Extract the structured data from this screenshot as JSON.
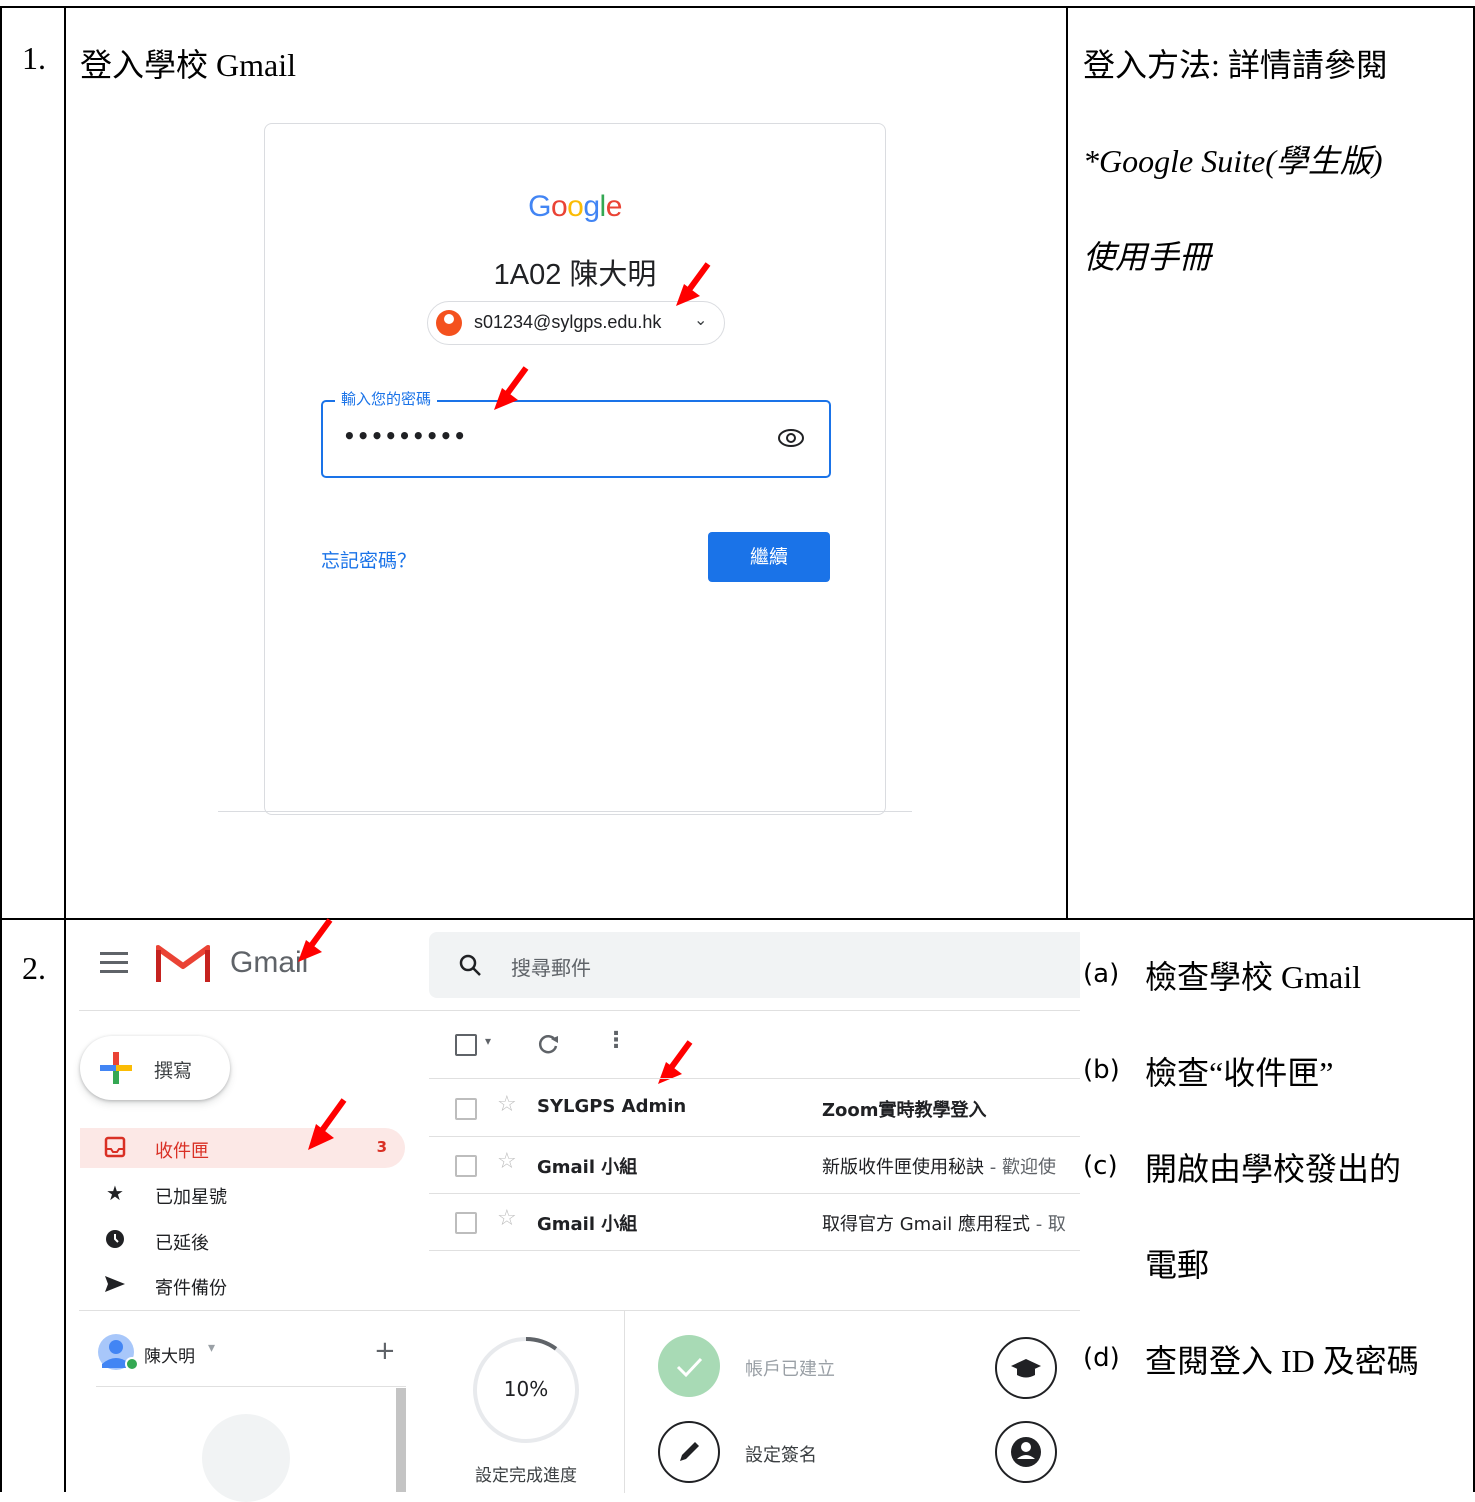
{
  "row1": {
    "number": "1.",
    "title": "登入學校 Gmail",
    "signin": {
      "logo_text": "Google",
      "name": "1A02 陳大明",
      "email": "s01234@sylgps.edu.hk",
      "password_label": "輸入您的密碼",
      "password_value": "•••••••••",
      "forgot_link": "忘記密碼？",
      "next_button": "繼續"
    },
    "side": {
      "line1": "登入方法: 詳情請參閱",
      "line2": "*Google Suite(學生版)",
      "line3": "使用手冊"
    }
  },
  "row2": {
    "number": "2.",
    "gmail": {
      "brand": "Gmail",
      "search_placeholder": "搜尋郵件",
      "compose": "撰寫",
      "nav": [
        {
          "label": "收件匣",
          "count": "3",
          "icon": "inbox-icon"
        },
        {
          "label": "已加星號",
          "count": "",
          "icon": "star-icon"
        },
        {
          "label": "已延後",
          "count": "",
          "icon": "clock-icon"
        },
        {
          "label": "寄件備份",
          "count": "",
          "icon": "send-icon"
        }
      ],
      "user": "陳大明",
      "emails": [
        {
          "sender": "SYLGPS Admin",
          "subject": "Zoom實時教學登入",
          "snippet": ""
        },
        {
          "sender": "Gmail 小組",
          "subject": "新版收件匣使用秘訣",
          "snippet": " - 歡迎使"
        },
        {
          "sender": "Gmail 小組",
          "subject": "取得官方 Gmail 應用程式",
          "snippet": " - 取"
        }
      ],
      "setup": {
        "progress": "10%",
        "progress_value": 0.1,
        "progress_label": "設定完成進度",
        "step1": "帳戶已建立",
        "step2": "設定簽名"
      }
    },
    "steps": [
      {
        "label": "(a)",
        "text": "檢查學校 Gmail"
      },
      {
        "label": "(b)",
        "text": "檢查“收件匣”"
      },
      {
        "label": "(c)",
        "text": "開啟由學校發出的"
      },
      {
        "label": "",
        "text": "電郵"
      },
      {
        "label": "(d)",
        "text": "查閱登入 ID 及密碼"
      }
    ]
  },
  "colors": {
    "accent_blue": "#1a73e8",
    "gmail_red": "#d93025",
    "arrow_red": "#ff0000"
  }
}
